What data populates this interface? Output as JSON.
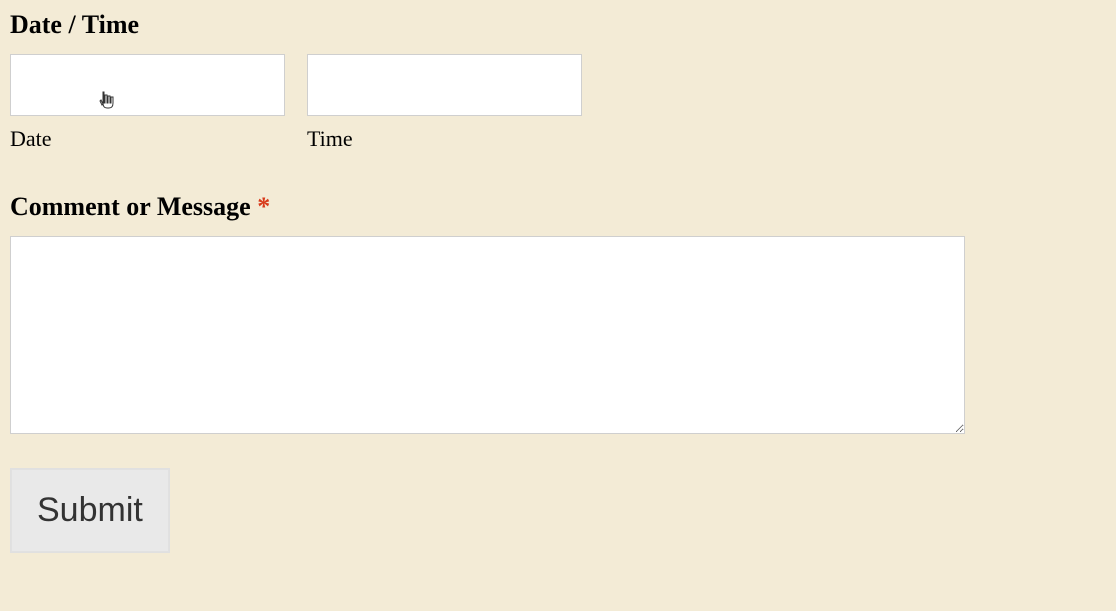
{
  "datetime": {
    "title": "Date / Time",
    "date": {
      "label": "Date",
      "value": ""
    },
    "time": {
      "label": "Time",
      "value": ""
    }
  },
  "comment": {
    "title": "Comment or Message ",
    "required_mark": "*",
    "value": ""
  },
  "actions": {
    "submit_label": "Submit"
  }
}
